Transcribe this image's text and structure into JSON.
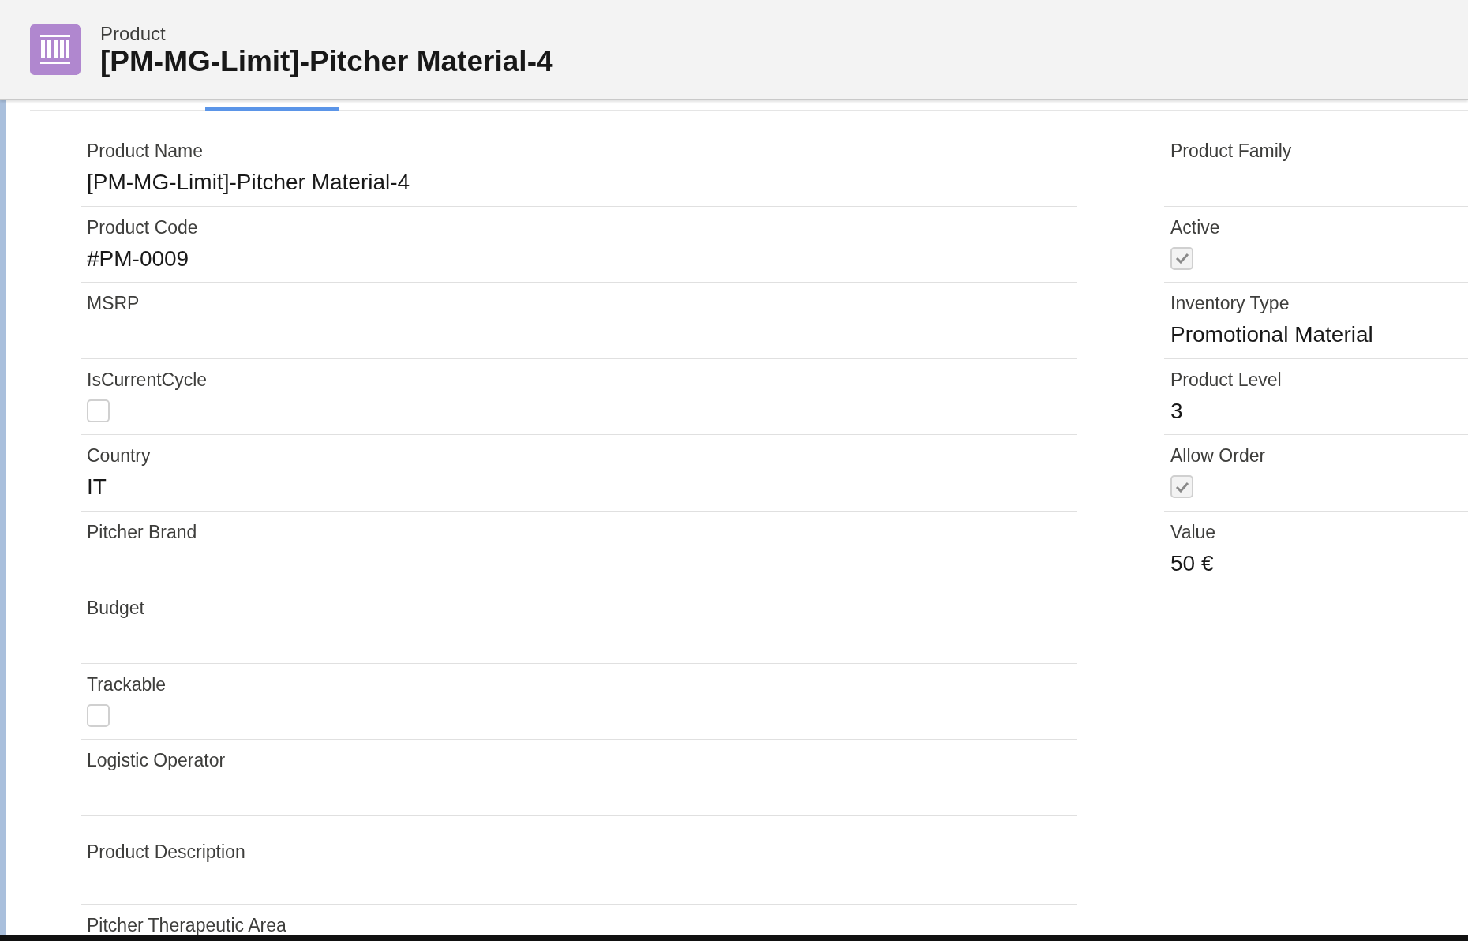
{
  "header": {
    "object_type": "Product",
    "title": "[PM-MG-Limit]-Pitcher Material-4"
  },
  "left_fields": [
    {
      "kind": "text",
      "label": "Product Name",
      "value": "[PM-MG-Limit]-Pitcher Material-4"
    },
    {
      "kind": "text",
      "label": "Product Code",
      "value": "#PM-0009"
    },
    {
      "kind": "text",
      "label": "MSRP"
    },
    {
      "kind": "checkbox",
      "label": "IsCurrentCycle",
      "checked": false
    },
    {
      "kind": "text",
      "label": "Country",
      "value": "IT"
    },
    {
      "kind": "text",
      "label": "Pitcher Brand"
    },
    {
      "kind": "text",
      "label": "Budget"
    },
    {
      "kind": "checkbox",
      "label": "Trackable",
      "checked": false
    },
    {
      "kind": "text",
      "label": "Logistic Operator"
    },
    {
      "kind": "textarea",
      "label": "Product Description"
    },
    {
      "kind": "text",
      "label": "Pitcher Therapeutic Area"
    }
  ],
  "right_fields": [
    {
      "kind": "text",
      "label": "Product Family"
    },
    {
      "kind": "checkbox",
      "label": "Active",
      "checked": true
    },
    {
      "kind": "text",
      "label": "Inventory Type",
      "value": "Promotional Material"
    },
    {
      "kind": "text",
      "label": "Product Level",
      "value": "3"
    },
    {
      "kind": "checkbox",
      "label": "Allow Order",
      "checked": true
    },
    {
      "kind": "text",
      "label": "Value",
      "value": "50 €"
    }
  ]
}
